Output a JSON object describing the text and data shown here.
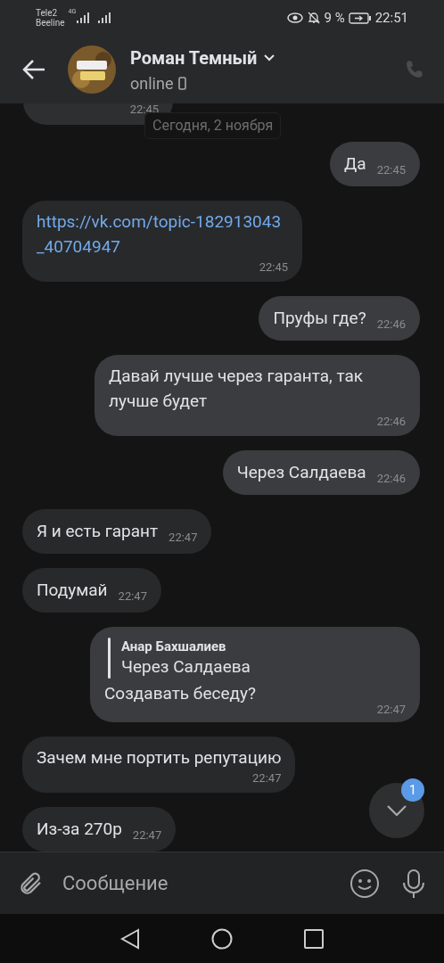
{
  "status_bar": {
    "carrier_1": "Tele2",
    "carrier_2": "Beeline",
    "network": "4G",
    "battery": "9 %",
    "time": "22:51"
  },
  "header": {
    "name": "Роман Темный",
    "status": "online"
  },
  "date_divider": "Сегодня, 2 ноября",
  "partial_message": {
    "time": "22:45"
  },
  "messages": [
    {
      "kind": "text",
      "outgoing": true,
      "text": "Да",
      "time": "22:45"
    },
    {
      "kind": "link",
      "outgoing": false,
      "text": "https://vk.com/topic-182913043_40704947",
      "time": "22:45"
    },
    {
      "kind": "text",
      "outgoing": true,
      "text": "Пруфы где?",
      "time": "22:46"
    },
    {
      "kind": "text",
      "outgoing": true,
      "text": "Давай лучше через гаранта, так лучше будет",
      "time": "22:46"
    },
    {
      "kind": "text",
      "outgoing": true,
      "text": "Через Салдаева",
      "time": "22:46"
    },
    {
      "kind": "text",
      "outgoing": false,
      "text": "Я и есть гарант",
      "time": "22:47"
    },
    {
      "kind": "text",
      "outgoing": false,
      "text": "Подумай",
      "time": "22:47"
    },
    {
      "kind": "reply",
      "outgoing": true,
      "quote_author": "Анар Бахшалиев",
      "quote_text": "Через Салдаева",
      "text": "Создавать беседу?",
      "time": "22:47"
    },
    {
      "kind": "text",
      "outgoing": false,
      "text": "Зачем мне портить репутацию",
      "time": "22:47"
    },
    {
      "kind": "text",
      "outgoing": false,
      "text": "Из-за 270р",
      "time": "22:47"
    }
  ],
  "scroll_button": {
    "badge": "1"
  },
  "composer": {
    "placeholder": "Сообщение"
  }
}
